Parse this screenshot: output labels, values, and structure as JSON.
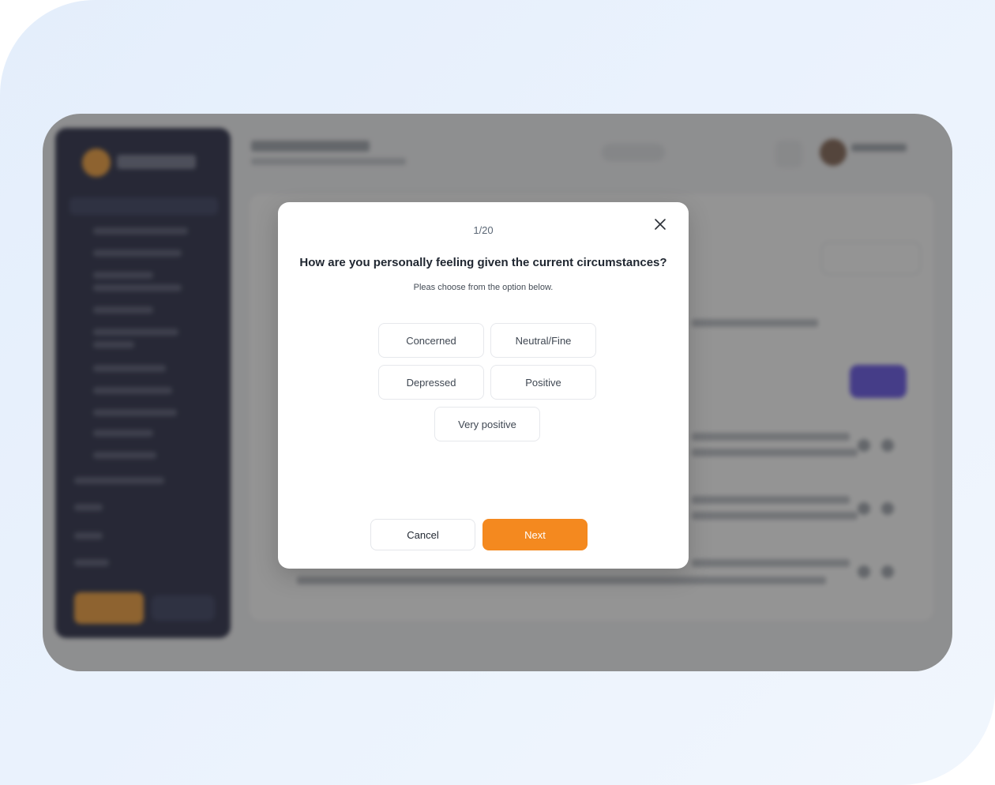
{
  "modal": {
    "counter": "1/20",
    "question": "How are you personally feeling given the current circumstances?",
    "hint": "Pleas choose from the option below.",
    "options": [
      {
        "label": "Concerned"
      },
      {
        "label": "Neutral/Fine"
      },
      {
        "label": "Depressed"
      },
      {
        "label": "Positive"
      },
      {
        "label": "Very positive"
      }
    ],
    "cancel_label": "Cancel",
    "next_label": "Next",
    "close_icon": "close-icon"
  },
  "colors": {
    "accent": "#f4891f",
    "overlay": "rgba(50,50,50,0.52)",
    "sidebar": "#1c1f3b",
    "purple_button": "#5b49e6"
  }
}
